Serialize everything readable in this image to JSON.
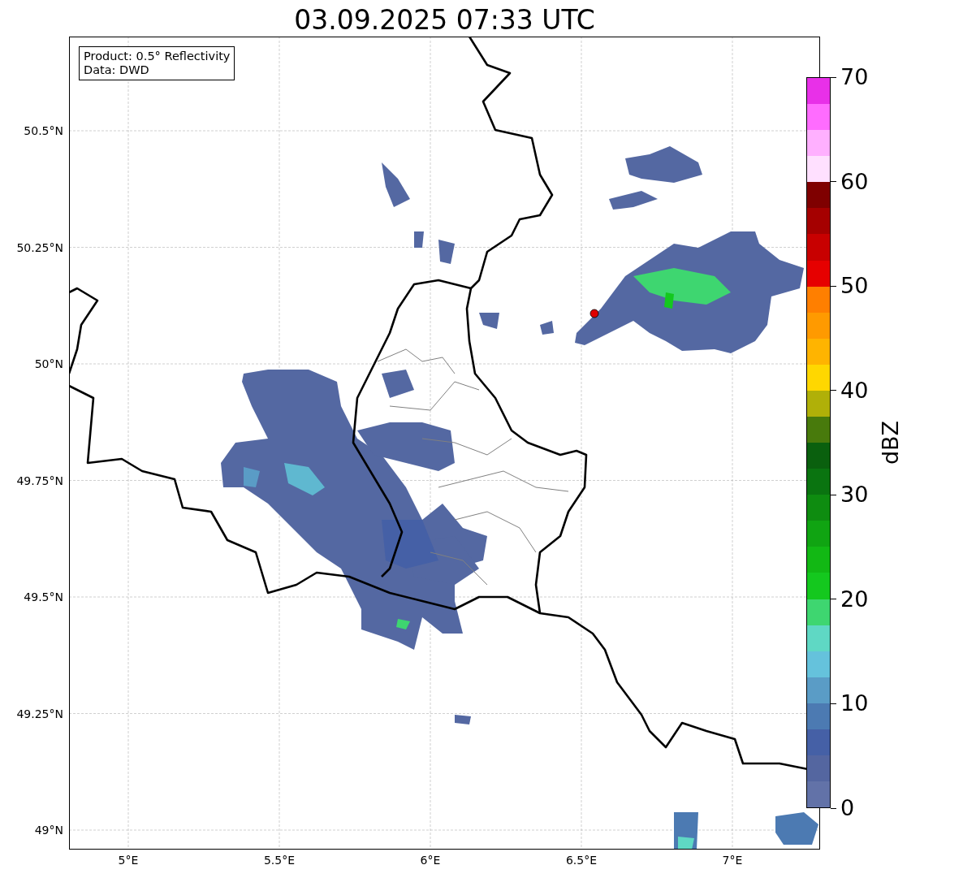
{
  "title": "03.09.2025 07:33 UTC",
  "info_box": {
    "lines": [
      "Product: 0.5° Reflectivity",
      "Data: DWD"
    ]
  },
  "map": {
    "x_ticks": [
      "5°E",
      "5.5°E",
      "6°E",
      "6.5°E",
      "7°E"
    ],
    "y_ticks": [
      "50.5°N",
      "50.25°N",
      "50°N",
      "49.75°N",
      "49.5°N",
      "49.25°N",
      "49°N"
    ]
  },
  "colorbar": {
    "label": "dBZ",
    "ticks": [
      "70",
      "60",
      "50",
      "40",
      "30",
      "20",
      "10",
      "0"
    ],
    "segments": [
      {
        "color": "#e830e8"
      },
      {
        "color": "#ff6cff"
      },
      {
        "color": "#ffb0ff"
      },
      {
        "color": "#ffe0ff"
      },
      {
        "color": "#7f0000"
      },
      {
        "color": "#a50000"
      },
      {
        "color": "#c80000"
      },
      {
        "color": "#e60000"
      },
      {
        "color": "#ff7f00"
      },
      {
        "color": "#ff9a00"
      },
      {
        "color": "#ffb400"
      },
      {
        "color": "#ffd700"
      },
      {
        "color": "#b0b008"
      },
      {
        "color": "#487a0c"
      },
      {
        "color": "#0a600e"
      },
      {
        "color": "#0a7410"
      },
      {
        "color": "#0e8c10"
      },
      {
        "color": "#10a412"
      },
      {
        "color": "#12b814"
      },
      {
        "color": "#14c81e"
      },
      {
        "color": "#3ed670"
      },
      {
        "color": "#5fd8c4"
      },
      {
        "color": "#65c2dc"
      },
      {
        "color": "#5a9cc6"
      },
      {
        "color": "#4c7ab2"
      },
      {
        "color": "#4560a6"
      },
      {
        "color": "#5466a0"
      },
      {
        "color": "#6272a8"
      }
    ]
  }
}
